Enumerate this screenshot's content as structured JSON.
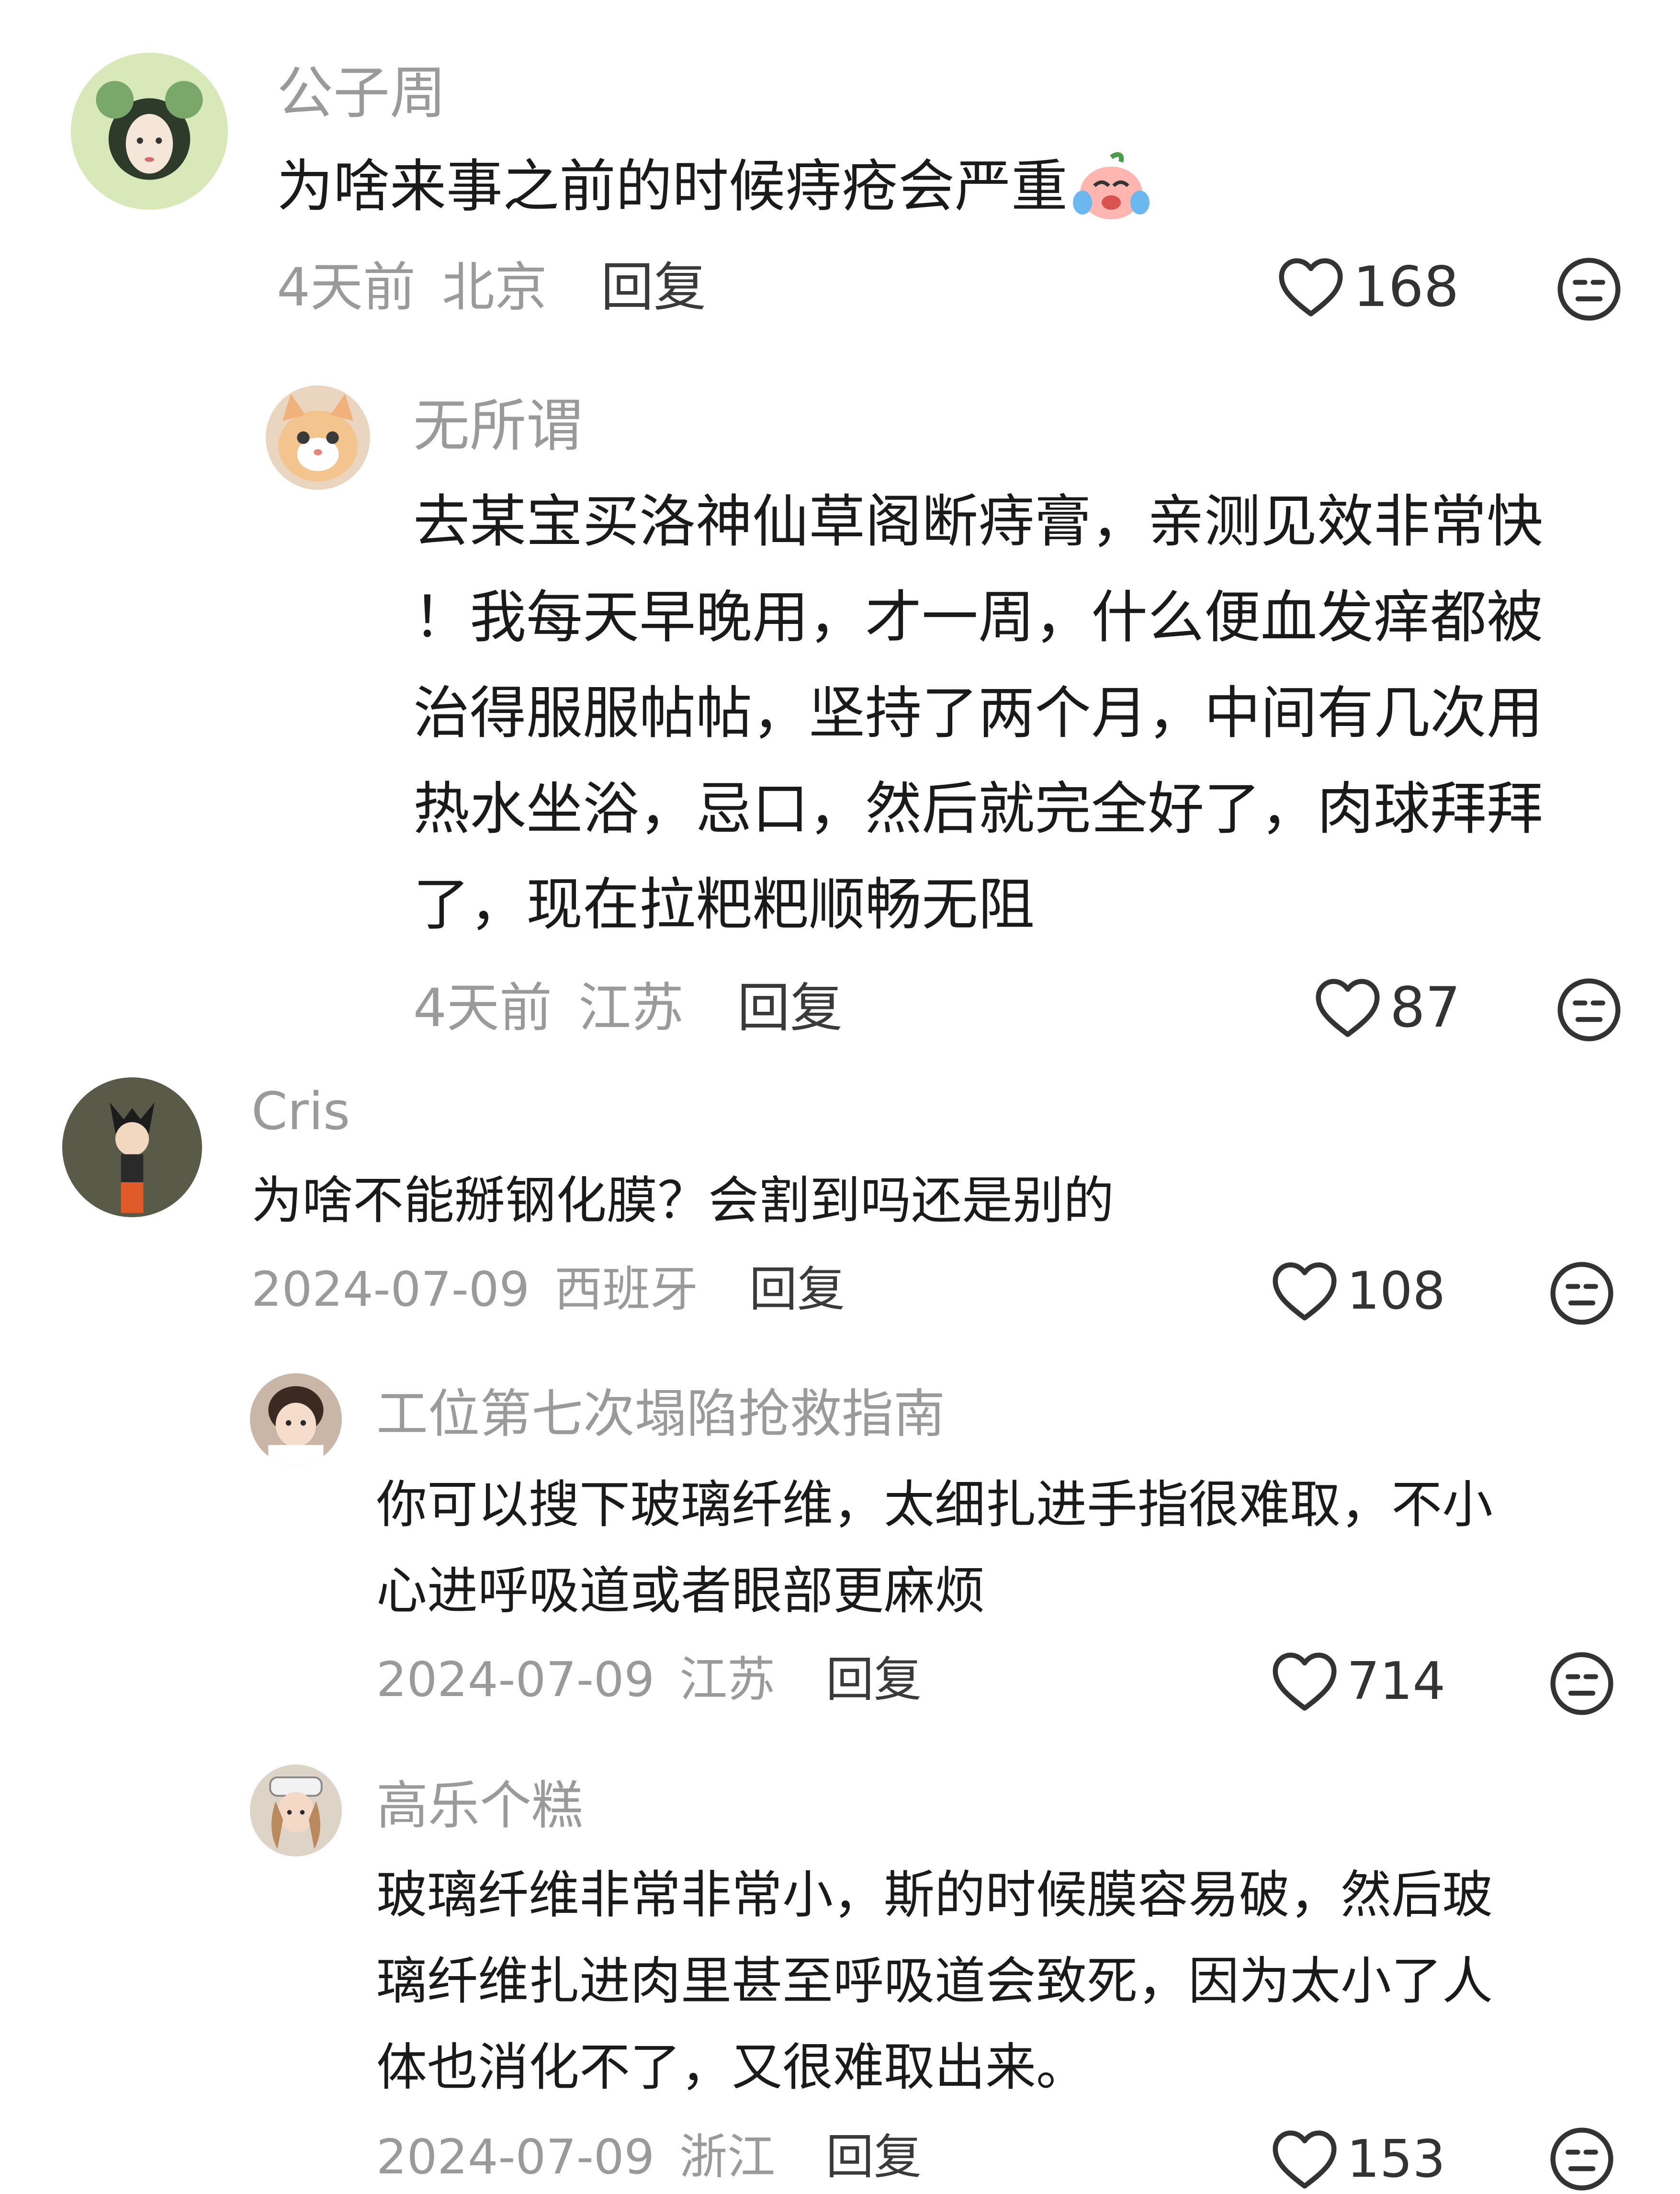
{
  "comments": [
    {
      "username": "公子周",
      "lines": [
        "为啥来事之前的时候痔疮会严重"
      ],
      "emoji": "crying-peach-emoji",
      "time": "4天前",
      "location": "北京",
      "reply": "回复",
      "likes": "168"
    },
    {
      "username": "无所谓",
      "lines": [
        "去某宝买洛神仙草阁断痔膏，亲测见效非常快",
        "！我每天早晚用，才一周，什么便血发痒都被",
        "治得服服帖帖，坚持了两个月，中间有几次用",
        "热水坐浴，忌口，然后就完全好了，肉球拜拜",
        "了，现在拉粑粑顺畅无阻"
      ],
      "time": "4天前",
      "location": "江苏",
      "reply": "回复",
      "likes": "87"
    },
    {
      "username": "Cris",
      "lines": [
        "为啥不能掰钢化膜？会割到吗还是别的"
      ],
      "time": "2024-07-09",
      "location": "西班牙",
      "reply": "回复",
      "likes": "108"
    },
    {
      "username": "工位第七次塌陷抢救指南",
      "lines": [
        "你可以搜下玻璃纤维，太细扎进手指很难取，不小",
        "心进呼吸道或者眼部更麻烦"
      ],
      "time": "2024-07-09",
      "location": "江苏",
      "reply": "回复",
      "likes": "714"
    },
    {
      "username": "高乐个糕",
      "lines": [
        "玻璃纤维非常非常小，斯的时候膜容易破，然后玻",
        "璃纤维扎进肉里甚至呼吸道会致死，因为太小了人",
        "体也消化不了，又很难取出来。"
      ],
      "time": "2024-07-09",
      "location": "浙江",
      "reply": "回复",
      "likes": "153"
    }
  ],
  "icons": {
    "like": "heart-outline-icon",
    "dislike": "neutral-face-icon"
  },
  "colors": {
    "username": "#9a9a9a",
    "meta": "#9a9a9a",
    "text": "#1a1a1a",
    "icon": "#333333"
  }
}
